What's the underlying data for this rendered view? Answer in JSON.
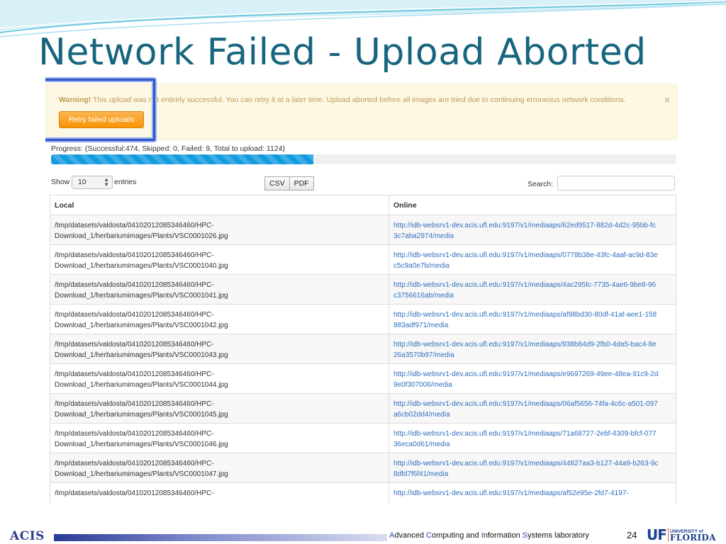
{
  "slide": {
    "title": "Network Failed - Upload Aborted",
    "page_number": "24"
  },
  "alert": {
    "strong": "Warning!",
    "message": " This upload was not entirely successful. You can retry it at a later time. Upload aborted before all images are tried due to continuing erroneous network conditions.",
    "close_label": "×",
    "retry_button": "Retry failed uploads"
  },
  "progress": {
    "label": "Progress: (Successful:474, Skipped: 0, Failed: 9, Total to upload: 1124)",
    "fraction": 0.42
  },
  "table_controls": {
    "show_label": "Show",
    "page_length": "10",
    "entries_label": "entries",
    "export_buttons": [
      "CSV",
      "PDF"
    ],
    "search_label": "Search:",
    "search_value": ""
  },
  "table": {
    "columns": [
      "Local",
      "Online"
    ],
    "rows": [
      {
        "local": "/tmp/datasets/valdosta/04102012085346460/HPC-Download_1/herbariumimages/Plants/VSC0001026.jpg",
        "online": "http://idb-websrv1-dev.acis.ufl.edu:9197/v1/mediaaps/62ed9517-882d-4d2c-95bb-fc3c7aba2974/media"
      },
      {
        "local": "/tmp/datasets/valdosta/04102012085346460/HPC-Download_1/herbariumimages/Plants/VSC0001040.jpg",
        "online": "http://idb-websrv1-dev.acis.ufl.edu:9197/v1/mediaaps/0778b38e-43fc-4aaf-ac9d-83ec5c9a0e7b/media"
      },
      {
        "local": "/tmp/datasets/valdosta/04102012085346460/HPC-Download_1/herbariumimages/Plants/VSC0001041.jpg",
        "online": "http://idb-websrv1-dev.acis.ufl.edu:9197/v1/mediaaps/4ac295fc-7735-4ae6-9be8-96c3756616ab/media"
      },
      {
        "local": "/tmp/datasets/valdosta/04102012085346460/HPC-Download_1/herbariumimages/Plants/VSC0001042.jpg",
        "online": "http://idb-websrv1-dev.acis.ufl.edu:9197/v1/mediaaps/af98bd30-80df-41af-aee1-158883adf971/media"
      },
      {
        "local": "/tmp/datasets/valdosta/04102012085346460/HPC-Download_1/herbariumimages/Plants/VSC0001043.jpg",
        "online": "http://idb-websrv1-dev.acis.ufl.edu:9197/v1/mediaaps/938b84d9-2fb0-4da5-bac4-8e26a3570b97/media"
      },
      {
        "local": "/tmp/datasets/valdosta/04102012085346460/HPC-Download_1/herbariumimages/Plants/VSC0001044.jpg",
        "online": "http://idb-websrv1-dev.acis.ufl.edu:9197/v1/mediaaps/e9697269-49ee-48ea-91c9-2d9e0f307006/media"
      },
      {
        "local": "/tmp/datasets/valdosta/04102012085346460/HPC-Download_1/herbariumimages/Plants/VSC0001045.jpg",
        "online": "http://idb-websrv1-dev.acis.ufl.edu:9197/v1/mediaaps/06af5656-74fa-4c6c-a501-097a6cb02dd4/media"
      },
      {
        "local": "/tmp/datasets/valdosta/04102012085346460/HPC-Download_1/herbariumimages/Plants/VSC0001046.jpg",
        "online": "http://idb-websrv1-dev.acis.ufl.edu:9197/v1/mediaaps/71a68727-2ebf-4309-bfcf-07736eca0d61/media"
      },
      {
        "local": "/tmp/datasets/valdosta/04102012085346460/HPC-Download_1/herbariumimages/Plants/VSC0001047.jpg",
        "online": "http://idb-websrv1-dev.acis.ufl.edu:9197/v1/mediaaps/44827aa3-b127-44a9-b263-9c8dfd7f6f41/media"
      },
      {
        "local": "/tmp/datasets/valdosta/04102012085346460/HPC-",
        "online": "http://idb-websrv1-dev.acis.ufl.edu:9197/v1/mediaaps/af52e95e-2fd7-4197-"
      }
    ]
  },
  "footer": {
    "acis_logo": "ACIS",
    "lab_name_parts": [
      {
        "cap": "A",
        "rest": "dvanced "
      },
      {
        "cap": "C",
        "rest": "omputing and "
      },
      {
        "cap": "I",
        "rest": "nformation "
      },
      {
        "cap": "S",
        "rest": "ystems laboratory"
      }
    ],
    "uf_mark": "UF",
    "uf_line1": "UNIVERSITY of",
    "uf_line2": "FLORIDA"
  },
  "colors": {
    "title": "#17657e",
    "alert_bg": "#fcf8e3",
    "alert_text": "#c09853",
    "retry_button": "#f89406",
    "progress_fill": "#149bdf",
    "link": "#2f6fbf",
    "highlight_border": "#3457c7"
  }
}
